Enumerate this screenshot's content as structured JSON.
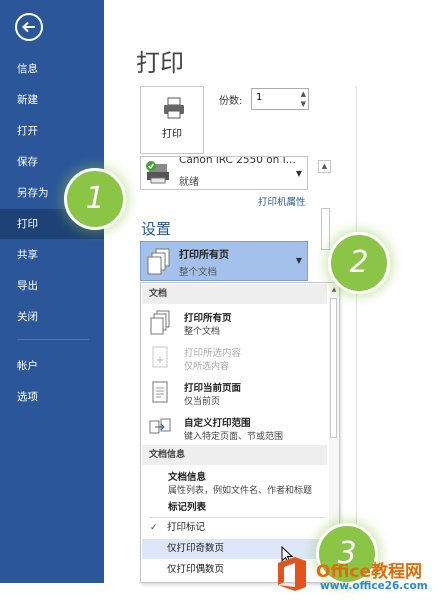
{
  "sidebar": {
    "items": [
      {
        "label": "信息"
      },
      {
        "label": "新建"
      },
      {
        "label": "打开"
      },
      {
        "label": "保存"
      },
      {
        "label": "另存为"
      },
      {
        "label": "打印",
        "active": true
      },
      {
        "label": "共享"
      },
      {
        "label": "导出"
      },
      {
        "label": "关闭"
      },
      {
        "label": "帐户"
      },
      {
        "label": "选项"
      }
    ]
  },
  "main": {
    "title": "打印",
    "print_button_label": "打印",
    "copies_label": "份数:",
    "copies_value": "1",
    "printer_name": "Canon iRC 2550 on I...",
    "printer_status": "就绪",
    "printer_properties_link": "打印机属性",
    "settings_title": "设置",
    "selected_setting": {
      "title": "打印所有页",
      "desc": "整个文档"
    }
  },
  "menu": {
    "section1_header": "文档",
    "items": [
      {
        "title": "打印所有页",
        "desc": "整个文档",
        "disabled": false
      },
      {
        "title": "打印所选内容",
        "desc": "仅所选内容",
        "disabled": true
      },
      {
        "title": "打印当前页面",
        "desc": "仅当前页",
        "disabled": false
      },
      {
        "title": "自定义打印范围",
        "desc": "键入特定页面、节或范围",
        "disabled": false
      }
    ],
    "section2_header": "文档信息",
    "doc_info": {
      "title": "文档信息",
      "desc": "属性列表，例如文件名、作者和标题"
    },
    "markup_list": {
      "title": "标记列表"
    },
    "print_markup": {
      "label": "打印标记",
      "checked": true
    },
    "odd_pages": {
      "label": "仅打印奇数页",
      "highlighted": true
    },
    "even_pages": {
      "label": "仅打印偶数页"
    }
  },
  "steps": [
    "1",
    "2",
    "3"
  ],
  "watermark": {
    "line1": "Office教程网",
    "line2": "www.office26.com"
  },
  "colors": {
    "sidebar": "#2b579a",
    "accent": "#2b579a",
    "badge": "#8bc545",
    "watermark_orange": "#e36c09",
    "watermark_blue": "#2a8bd0"
  }
}
